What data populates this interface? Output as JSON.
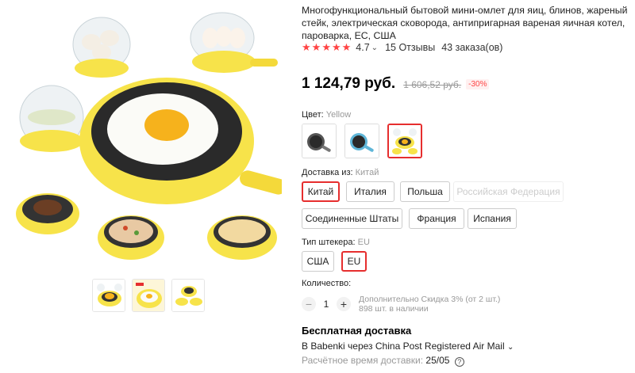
{
  "product": {
    "title": "Многофункциональный бытовой мини-омлет для яиц, блинов, жареный стейк, электрическая сковорода, антипригарная вареная яичная котел, пароварка, ЕС, США",
    "rating": "4.7",
    "reviews": "15 Отзывы",
    "orders": "43 заказа(ов)",
    "price": "1 124,79 руб.",
    "old_price": "1 606,52 руб.",
    "discount": "-30%",
    "stars_filled": 5
  },
  "color": {
    "label": "Цвет:",
    "selected": "Yellow",
    "selected_index": 2,
    "swatch_icons": [
      "pan-gray-icon",
      "pan-blue-icon",
      "pan-yellow-icon"
    ]
  },
  "shipping_from": {
    "label": "Доставка из:",
    "selected": "Китай",
    "options": [
      "Китай",
      "Италия",
      "Польша",
      "Российская Федерация",
      "Соединенные Штаты",
      "Франция",
      "Испания"
    ]
  },
  "plug": {
    "label": "Тип штекера:",
    "selected": "EU",
    "options": [
      "США",
      "EU"
    ]
  },
  "quantity": {
    "label": "Количество:",
    "value": "1",
    "minus": "−",
    "plus": "+",
    "discount_note": "Дополнительно Скидка 3% (от 2 шт.)",
    "stock": "898 шт. в наличии"
  },
  "delivery": {
    "title": "Бесплатная доставка",
    "line": "В Babenki через China Post Registered Air Mail",
    "est_label": "Расчётное время доставки:",
    "est_date": "25/05",
    "help": "?"
  },
  "gallery": {
    "thumb_icons": [
      "thumb-cooker-icon",
      "thumb-pan-icon",
      "thumb-set-icon"
    ]
  },
  "colors": {
    "accent": "#e62e2e",
    "star": "#ff4444",
    "yellow": "#f7e34a"
  }
}
